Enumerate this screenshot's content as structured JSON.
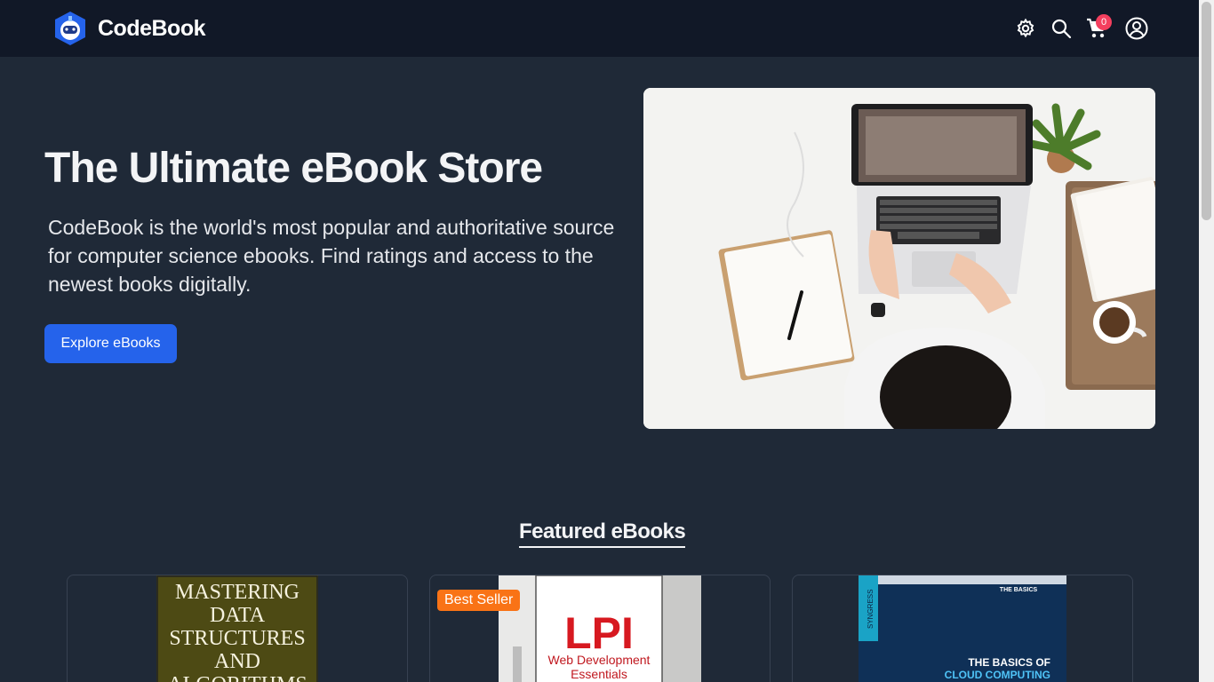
{
  "brand": {
    "name": "CodeBook",
    "logo_icon": "astronaut-logo-icon"
  },
  "header": {
    "icons": [
      "settings-icon",
      "search-icon",
      "cart-icon",
      "user-icon"
    ],
    "cart_count": "0"
  },
  "hero": {
    "title": "The Ultimate eBook Store",
    "description": "CodeBook is the world's most popular and authoritative source for computer science ebooks. Find ratings and access to the newest books digitally.",
    "cta_label": "Explore eBooks"
  },
  "featured": {
    "title": "Featured eBooks",
    "cards": [
      {
        "cover_lines": [
          "MASTERING",
          "DATA",
          "STRUCTURES",
          "AND",
          "ALGORITHMS"
        ],
        "badge": ""
      },
      {
        "cover_title": "LPI",
        "cover_subtitle_1": "Web Development",
        "cover_subtitle_2": "Essentials",
        "badge": "Best Seller"
      },
      {
        "cover_series": "THE BASICS",
        "cover_title_1": "THE BASICS OF",
        "cover_title_2": "CLOUD COMPUTING",
        "cover_publisher": "SYNGRESS",
        "badge": ""
      }
    ]
  },
  "colors": {
    "page_bg": "#1f2937",
    "navbar_bg": "#111827",
    "primary": "#2563eb",
    "badge_best_seller": "#f97316",
    "cart_badge": "#f43f5e"
  }
}
